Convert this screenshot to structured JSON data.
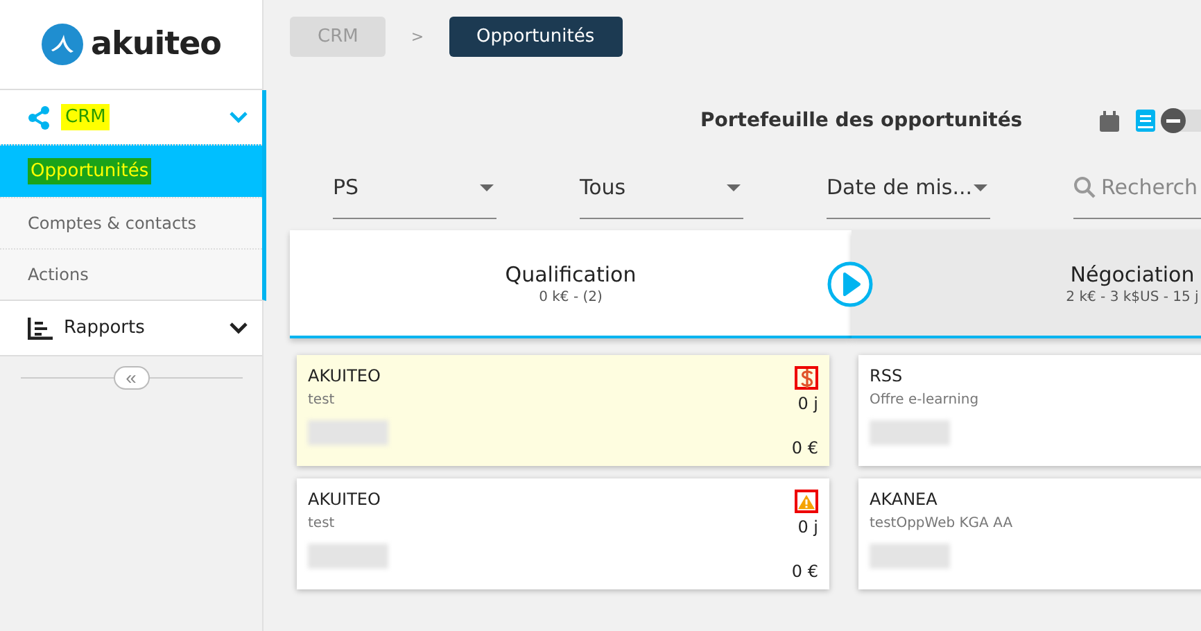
{
  "logo": {
    "text": "akuiteo"
  },
  "sidebar": {
    "sections": [
      {
        "kind": "share",
        "label": "CRM",
        "expanded": true,
        "items": [
          {
            "label": "Opportunités",
            "selected": true
          },
          {
            "label": "Comptes & contacts",
            "selected": false
          },
          {
            "label": "Actions",
            "selected": false
          }
        ]
      },
      {
        "kind": "chart",
        "label": "Rapports",
        "expanded": false
      }
    ],
    "collapse": {
      "label": "«"
    }
  },
  "breadcrumb": [
    {
      "label": "CRM",
      "selected": false
    },
    {
      "label": "Opportunités",
      "selected": true
    }
  ],
  "breadcrumb_separator": ">",
  "page_title": "Portefeuille des opportunités",
  "view_buttons": [
    {
      "kind": "calendar",
      "selected": false
    },
    {
      "kind": "book",
      "selected": true
    }
  ],
  "toggle": {
    "on": false
  },
  "filters": [
    {
      "value": "PS"
    },
    {
      "value": "Tous"
    },
    {
      "value": "Date de mis..."
    }
  ],
  "search": {
    "placeholder": "Recherch"
  },
  "columns": [
    {
      "title": "Qualification",
      "summary": "0 k€ - (2)",
      "selected": true,
      "cards": [
        {
          "company": "AKUITEO",
          "subject": "test",
          "days": "0 j",
          "amount": "0 €",
          "highlighted": true,
          "kind": "dollar"
        },
        {
          "company": "AKUITEO",
          "subject": "test",
          "days": "0 j",
          "amount": "0 €",
          "highlighted": false,
          "kind": "warning"
        }
      ]
    },
    {
      "title": "Négociation",
      "summary": "2 k€ - 3 k$US - 15 j",
      "selected": false,
      "cards": [
        {
          "company": "RSS",
          "subject": "Offre e-learning",
          "highlighted": false
        },
        {
          "company": "AKANEA",
          "subject": "testOppWeb KGA AA",
          "highlighted": false
        }
      ]
    }
  ]
}
